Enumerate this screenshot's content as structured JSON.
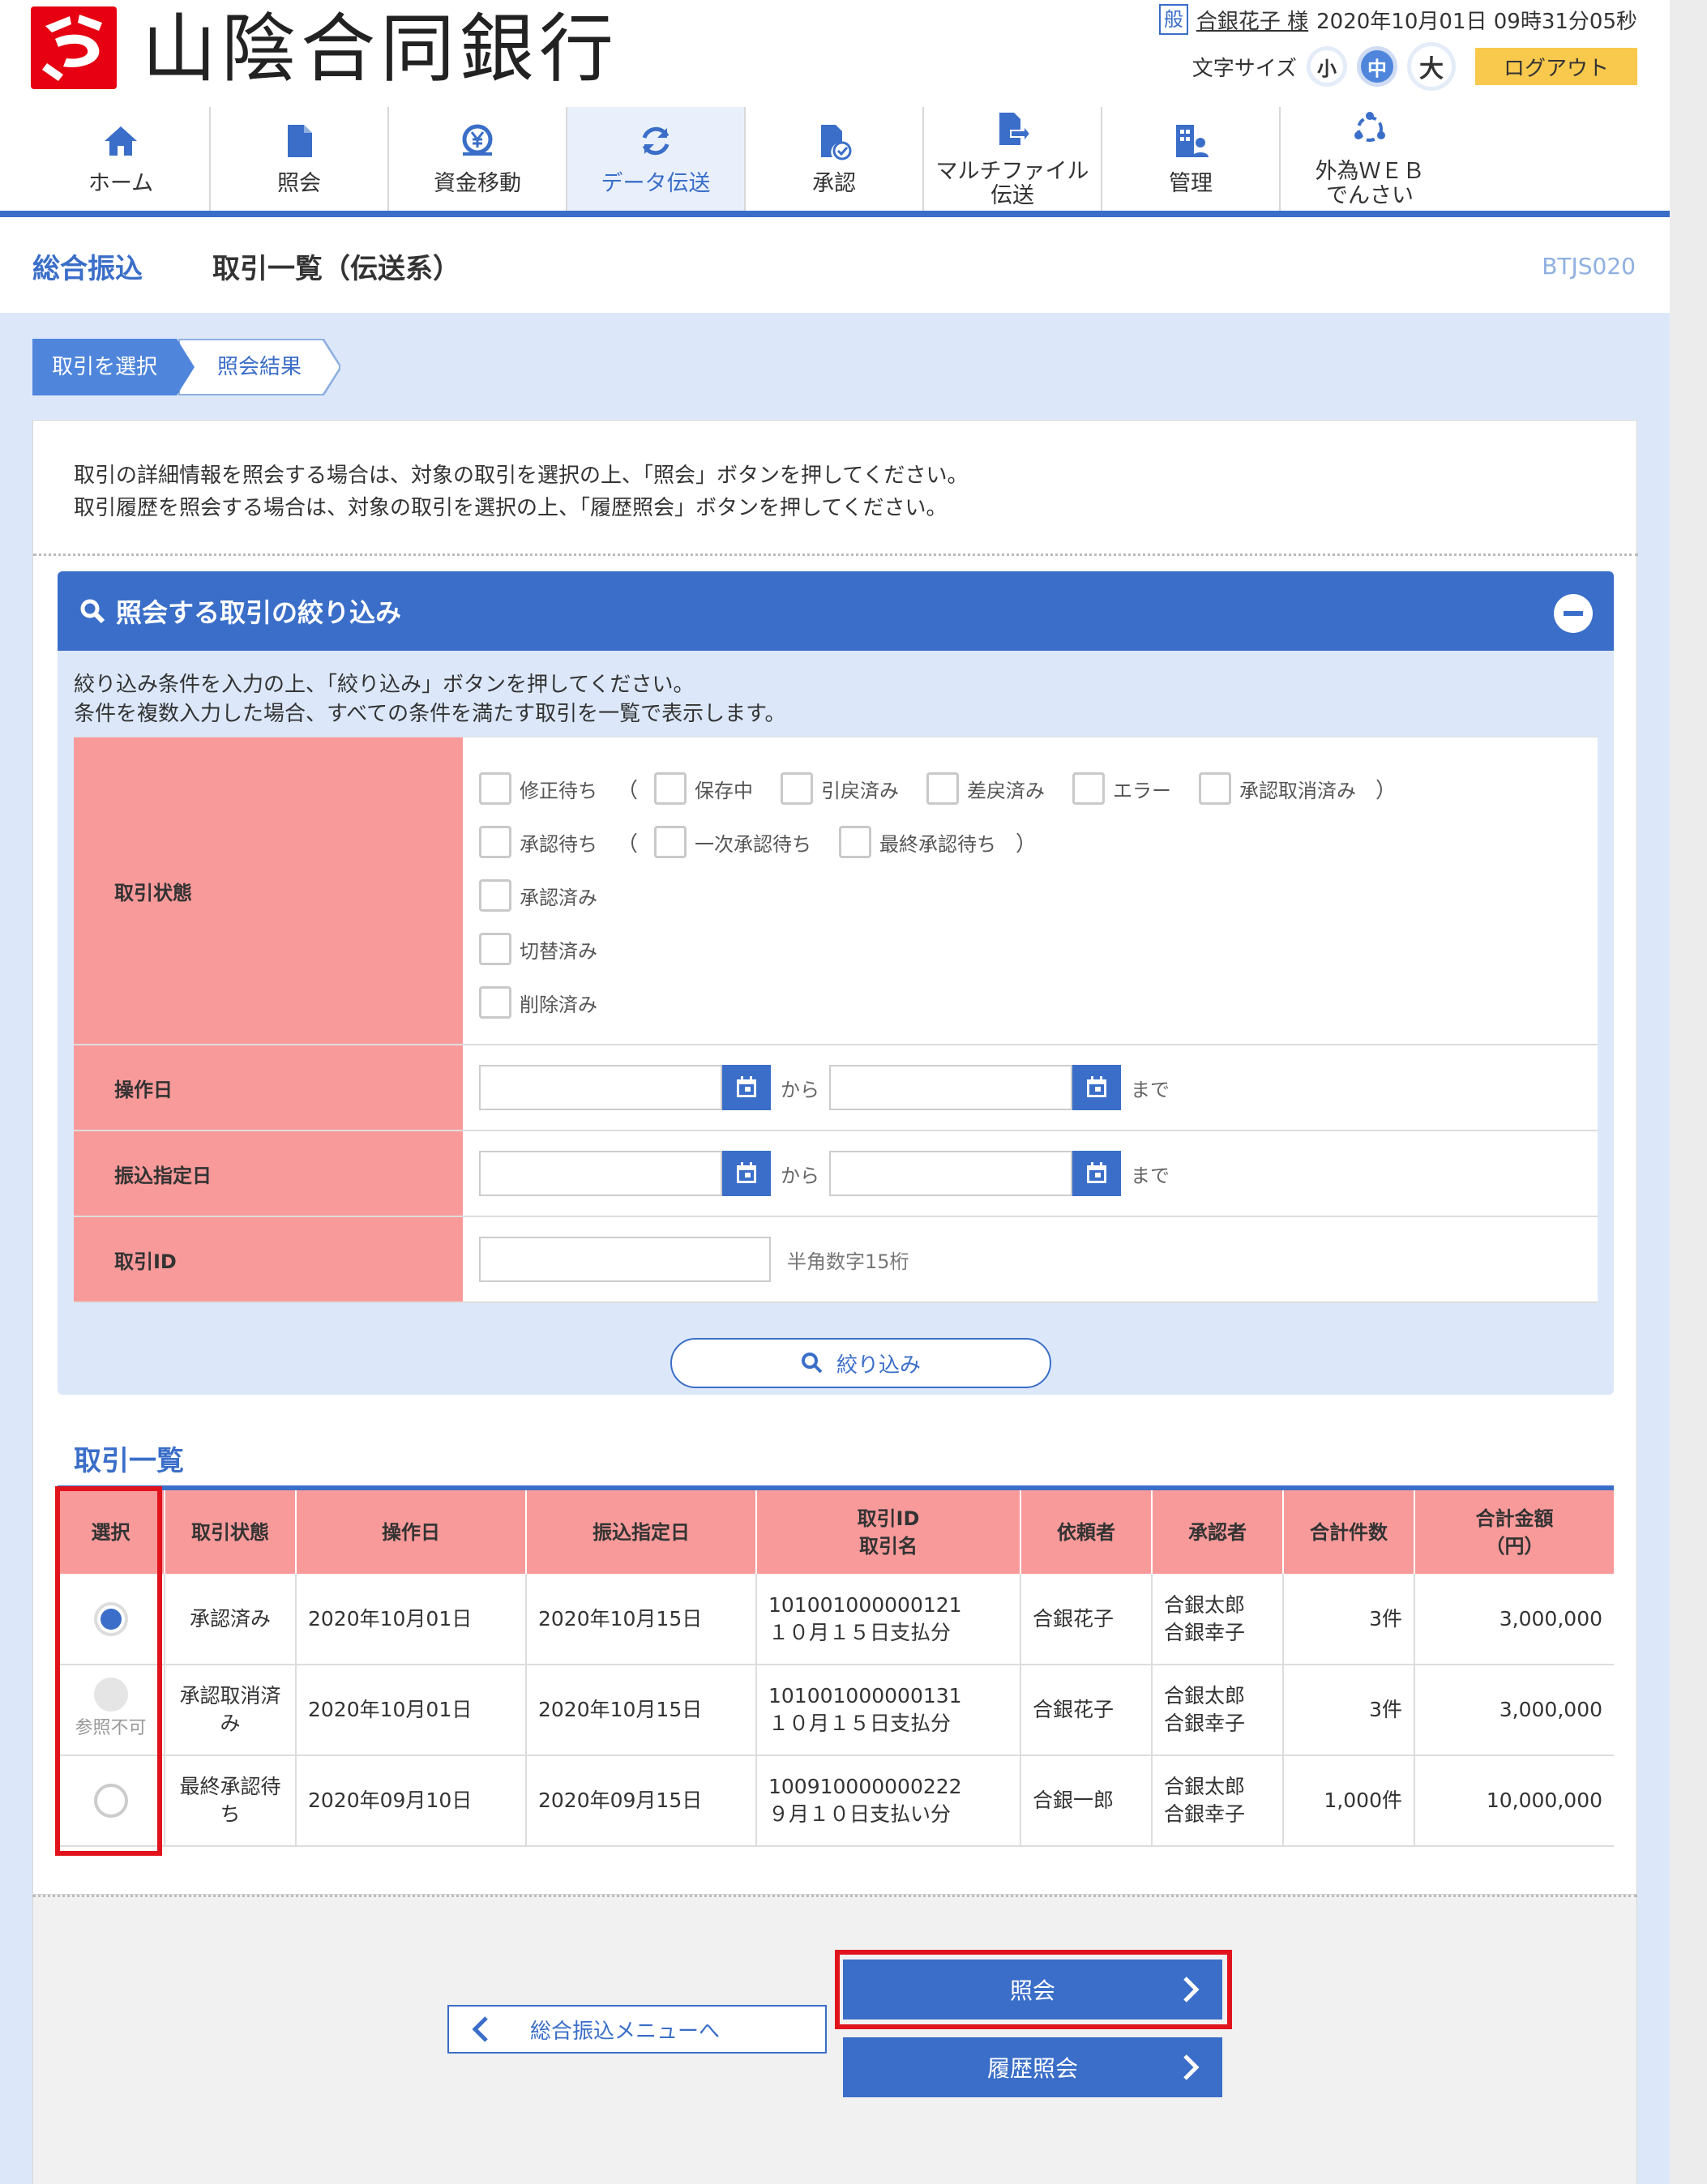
{
  "header": {
    "bank_name": "山陰合同銀行",
    "user_type": "般",
    "user_name": "合銀花子 様",
    "datetime": "2020年10月01日 09時31分05秒",
    "font_size_label": "文字サイズ",
    "font_sizes": [
      "小",
      "中",
      "大"
    ],
    "font_size_selected": "中",
    "logout_label": "ログアウト"
  },
  "nav": {
    "items": [
      {
        "label": "ホーム",
        "icon": "home-icon"
      },
      {
        "label": "照会",
        "icon": "document-icon"
      },
      {
        "label": "資金移動",
        "icon": "yen-transfer-icon"
      },
      {
        "label": "データ伝送",
        "icon": "refresh-icon"
      },
      {
        "label": "承認",
        "icon": "approve-document-icon"
      },
      {
        "label": "マルチファイル伝送",
        "icon": "file-transfer-icon"
      },
      {
        "label": "管理",
        "icon": "management-icon"
      },
      {
        "label": "外為WEBでんさい",
        "icon": "network-icon"
      }
    ],
    "item6_line1": "マルチファイル",
    "item6_line2": "伝送",
    "item8_line1": "外為ＷＥＢ",
    "item8_line2": "でんさい",
    "active": "データ伝送"
  },
  "title": {
    "main": "総合振込",
    "sub": "取引一覧（伝送系）",
    "screen_id": "BTJS020"
  },
  "steps": [
    "取引を選択",
    "照会結果"
  ],
  "intro": {
    "line1": "取引の詳細情報を照会する場合は、対象の取引を選択の上、「照会」ボタンを押してください。",
    "line2": "取引履歴を照会する場合は、対象の取引を選択の上、「履歴照会」ボタンを押してください。"
  },
  "filter": {
    "title": "照会する取引の絞り込み",
    "desc1": "絞り込み条件を入力の上、「絞り込み」ボタンを押してください。",
    "desc2": "条件を複数入力した場合、すべての条件を満たす取引を一覧で表示します。",
    "status_label": "取引状態",
    "status_row1": [
      "修正待ち",
      "保存中",
      "引戻済み",
      "差戻済み",
      "エラー",
      "承認取消済み"
    ],
    "status_row2": [
      "承認待ち",
      "一次承認待ち",
      "最終承認待ち"
    ],
    "status_row3": "承認済み",
    "status_row4": "切替済み",
    "status_row5": "削除済み",
    "open_paren": "（",
    "close_paren": "）",
    "op_date_label": "操作日",
    "transfer_date_label": "振込指定日",
    "from": "から",
    "to": "まで",
    "trade_id_label": "取引ID",
    "trade_id_hint": "半角数字15桁",
    "button": "絞り込み"
  },
  "list": {
    "title": "取引一覧",
    "headers": {
      "select": "選択",
      "status": "取引状態",
      "op_date": "操作日",
      "transfer_date": "振込指定日",
      "id_line1": "取引ID",
      "id_line2": "取引名",
      "requester": "依頼者",
      "approver": "承認者",
      "count": "合計件数",
      "amount_line1": "合計金額",
      "amount_line2": "（円）"
    },
    "rows": [
      {
        "select": "checked",
        "status": "承認済み",
        "op_date": "2020年10月01日",
        "transfer_date": "2020年10月15日",
        "id": "101001000000121",
        "name": "１０月１５日支払分",
        "requester": "合銀花子",
        "approver1": "合銀太郎",
        "approver2": "合銀幸子",
        "count": "3件",
        "amount": "3,000,000"
      },
      {
        "select": "disabled",
        "select_note": "参照不可",
        "status": "承認取消済み",
        "op_date": "2020年10月01日",
        "transfer_date": "2020年10月15日",
        "id": "101001000000131",
        "name": "１０月１５日支払分",
        "requester": "合銀花子",
        "approver1": "合銀太郎",
        "approver2": "合銀幸子",
        "count": "3件",
        "amount": "3,000,000"
      },
      {
        "select": "unchecked",
        "status": "最終承認待ち",
        "op_date": "2020年09月10日",
        "transfer_date": "2020年09月15日",
        "id": "100910000000222",
        "name": "９月１０日支払い分",
        "requester": "合銀一郎",
        "approver1": "合銀太郎",
        "approver2": "合銀幸子",
        "count": "1,000件",
        "amount": "10,000,000"
      }
    ]
  },
  "footer": {
    "back": "総合振込メニューへ",
    "inquiry": "照会",
    "history": "履歴照会"
  },
  "colors": {
    "primary": "#3a6ec8",
    "header_pink": "#f99a9a",
    "highlight_red": "#e1141d",
    "logout_yellow": "#f9c94d"
  }
}
